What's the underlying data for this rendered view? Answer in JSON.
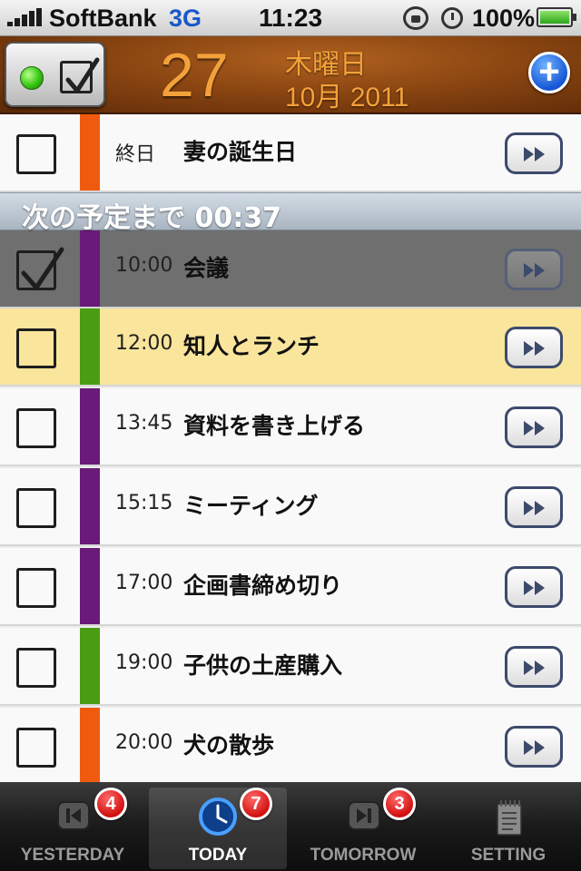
{
  "status_bar": {
    "carrier": "SoftBank",
    "network": "3G",
    "time": "11:23",
    "battery": "100%"
  },
  "header": {
    "day": "27",
    "weekday": "木曜日",
    "month_year": "10月 2011",
    "add_icon": "plus-icon",
    "toggle_icon": "checkbox-icon"
  },
  "countdown": {
    "text": "次の予定まで 00:37"
  },
  "events": [
    {
      "time": "終日",
      "title": "妻の誕生日",
      "color": "#f05a0f",
      "checked": false,
      "state": "normal"
    },
    {
      "time": "10:00",
      "title": "会議",
      "color": "#6a1a78",
      "checked": true,
      "state": "done"
    },
    {
      "time": "12:00",
      "title": "知人とランチ",
      "color": "#4a9d12",
      "checked": false,
      "state": "current"
    },
    {
      "time": "13:45",
      "title": "資料を書き上げる",
      "color": "#6a1a78",
      "checked": false,
      "state": "normal"
    },
    {
      "time": "15:15",
      "title": "ミーティング",
      "color": "#6a1a78",
      "checked": false,
      "state": "normal"
    },
    {
      "time": "17:00",
      "title": "企画書締め切り",
      "color": "#6a1a78",
      "checked": false,
      "state": "normal"
    },
    {
      "time": "19:00",
      "title": "子供の土産購入",
      "color": "#4a9d12",
      "checked": false,
      "state": "normal"
    },
    {
      "time": "20:00",
      "title": "犬の散歩",
      "color": "#f05a0f",
      "checked": false,
      "state": "normal"
    }
  ],
  "tabs": [
    {
      "label": "YESTERDAY",
      "badge": "4",
      "icon": "skip-back-icon",
      "active": false
    },
    {
      "label": "TODAY",
      "badge": "7",
      "icon": "clock-icon",
      "active": true
    },
    {
      "label": "TOMORROW",
      "badge": "3",
      "icon": "skip-forward-icon",
      "active": false
    },
    {
      "label": "SETTING",
      "badge": "",
      "icon": "notepad-icon",
      "active": false
    }
  ]
}
